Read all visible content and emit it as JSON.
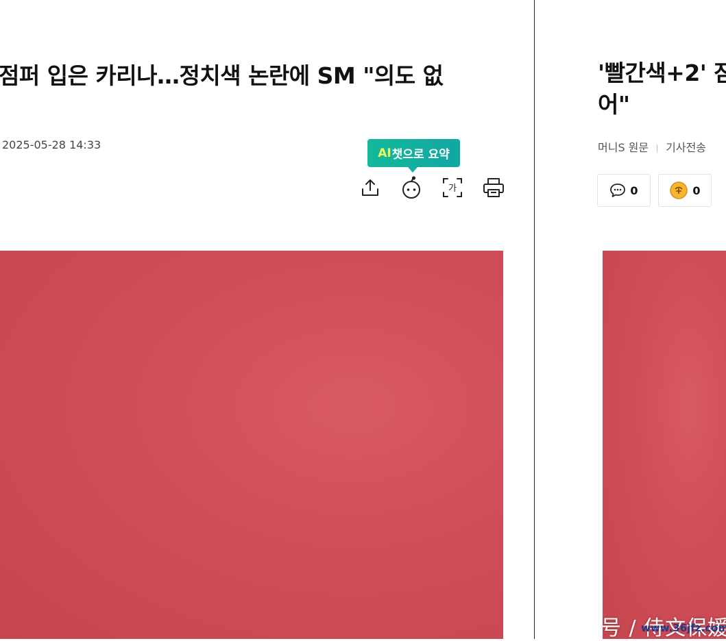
{
  "left_article": {
    "title": "점퍼 입은 카리나…정치색 논란에 SM \"의도 없",
    "datetime": "2025-05-28 14:33",
    "ai_summary": {
      "prefix": "AI",
      "label": "챗으로 요약"
    },
    "tools": [
      {
        "name": "share-icon"
      },
      {
        "name": "ai-chat-bot-icon"
      },
      {
        "name": "font-size-icon"
      },
      {
        "name": "print-icon"
      }
    ]
  },
  "right_article": {
    "title_line1": "'빨간색+2' 잠",
    "title_line2": "어\"",
    "source": "머니S 원문",
    "sent_time": "기사전송",
    "comment_count": "0",
    "reaction_count": "0"
  },
  "watermark": {
    "text": "号 / 侍文保媛",
    "url": "www.36jfz.com"
  },
  "colors": {
    "ai_bubble": "#13afa0",
    "photo_background": "#cf4d57",
    "divider": "#222222"
  }
}
